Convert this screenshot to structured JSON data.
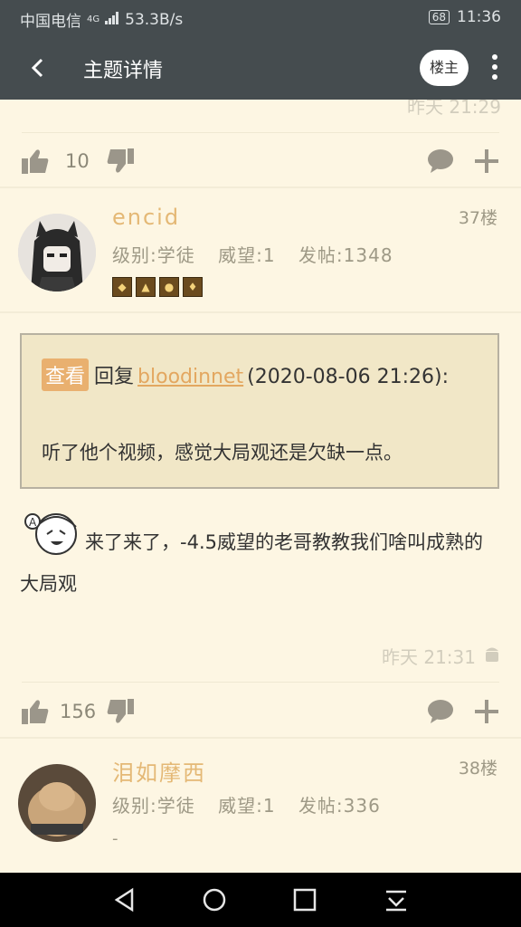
{
  "status": {
    "carrier": "中国电信",
    "network": "4G",
    "speed": "53.3B/s",
    "battery": "68",
    "time": "11:36"
  },
  "appbar": {
    "title": "主题详情",
    "louzhu": "楼主"
  },
  "prev": {
    "time": "昨天 21:29",
    "likes": "10"
  },
  "post37": {
    "username": "encid",
    "floor": "37楼",
    "level": "级别:学徒",
    "reputation": "威望:1",
    "posts": "发帖:1348",
    "quote": {
      "tag": "查看",
      "reply": "回复",
      "link": "bloodinnet",
      "date": "(2020-08-06 21:26):",
      "text": "听了他个视频，感觉大局观还是欠缺一点。"
    },
    "body": "来了来了，-4.5威望的老哥教教我们啥叫成熟的大局观",
    "time": "昨天 21:31",
    "likes": "156"
  },
  "post38": {
    "username": "泪如摩西",
    "floor": "38楼",
    "level": "级别:学徒",
    "reputation": "威望:1",
    "posts": "发帖:336",
    "extra": "-"
  }
}
